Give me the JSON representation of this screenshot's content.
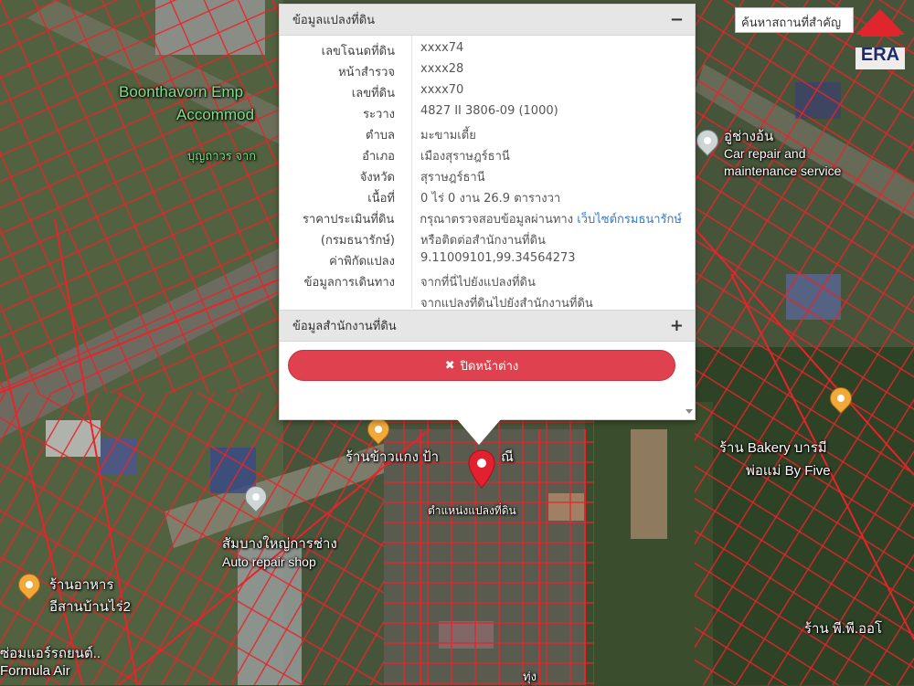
{
  "search": {
    "placeholder": "ค้นหาสถานที่สำคัญ"
  },
  "logo": {
    "text": "ERA"
  },
  "panel": {
    "title": "ข้อมูลแปลงที่ดิน",
    "collapse_icon": "minus-icon",
    "rows": [
      {
        "label": "เลขโฉนดที่ดิน",
        "value": "xxxx74"
      },
      {
        "label": "หน้าสำรวจ",
        "value": "xxxx28"
      },
      {
        "label": "เลขที่ดิน",
        "value": "xxxx70"
      },
      {
        "label": "ระวาง",
        "value": "4827 II 3806-09 (1000)"
      },
      {
        "label": "ตำบล",
        "value": "มะขามเตี้ย"
      },
      {
        "label": "อำเภอ",
        "value": "เมืองสุราษฎร์ธานี"
      },
      {
        "label": "จังหวัด",
        "value": "สุราษฎร์ธานี"
      },
      {
        "label": "เนื้อที่",
        "value": "0 ไร่ 0 งาน 26.9 ตารางวา"
      }
    ],
    "price": {
      "label1": "ราคาประเมินที่ดิน",
      "label2": "(กรมธนารักษ์)",
      "text1": "กรุณาตรวจสอบข้อมูลผ่านทาง",
      "link1": "เว็บไซต์กรมธนารักษ์",
      "text2": "หรือติดต่อสำนักงานที่ดิน"
    },
    "coords": {
      "label": "ค่าพิกัดแปลง",
      "value": "9.11009101,99.34564273"
    },
    "travel": {
      "label": "ข้อมูลการเดินทาง",
      "link1": "จากที่นี่ไปยังแปลงที่ดิน",
      "link2": "จากแปลงที่ดินไปยังสำนักงานที่ดิน"
    },
    "office_section": {
      "title": "ข้อมูลสำนักงานที่ดิน",
      "expand_icon": "plus-icon"
    },
    "close_button": {
      "icon": "close-icon",
      "label": "ปิดหน้าต่าง"
    }
  },
  "map": {
    "labels": [
      {
        "id": "boonthavorn",
        "text": "Boonthavorn Emp"
      },
      {
        "id": "accommod",
        "text": "Accommod"
      },
      {
        "id": "boonthavorn_th",
        "text": "บุญถาวร จาก"
      },
      {
        "id": "repair_th",
        "text": "อู่ช่างอ้น"
      },
      {
        "id": "repair_en1",
        "text": "Car repair and"
      },
      {
        "id": "repair_en2",
        "text": "maintenance service"
      },
      {
        "id": "curry",
        "text": "ร้านข้าวแกง ป้า"
      },
      {
        "id": "curry2",
        "text": "ณี"
      },
      {
        "id": "parcel",
        "text": "ตำแหน่งแปลงที่ดิน"
      },
      {
        "id": "bakery1",
        "text": "ร้าน Bakery บารมี"
      },
      {
        "id": "bakery2",
        "text": "พ่อแม่ By Five"
      },
      {
        "id": "sombang",
        "text": "สัมบางใหญ่การช่าง"
      },
      {
        "id": "autorepair",
        "text": "Auto repair shop"
      },
      {
        "id": "food1",
        "text": "ร้านอาหาร"
      },
      {
        "id": "food2",
        "text": "อีสานบ้านไร่2"
      },
      {
        "id": "aircon",
        "text": "ซ่อมแอร์รถยนต์.."
      },
      {
        "id": "formula",
        "text": "Formula Air"
      },
      {
        "id": "pp",
        "text": "ร้าน พี.พี.ออโ"
      },
      {
        "id": "tail",
        "text": "ทุ่ง"
      }
    ]
  },
  "colors": {
    "parcel_lines": "#e8232a",
    "close_button": "#e0414f",
    "link": "#2f7ad1",
    "marker": "#e2202f"
  }
}
